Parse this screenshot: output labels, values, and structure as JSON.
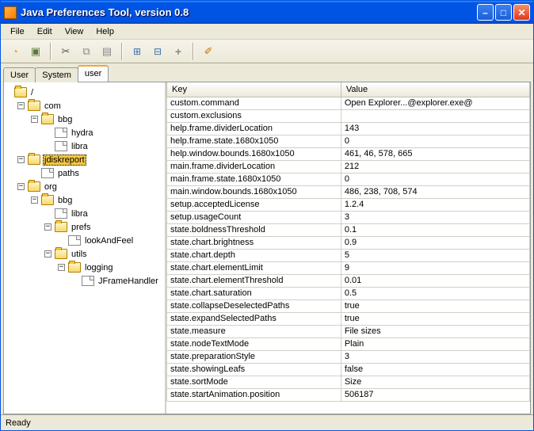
{
  "window": {
    "title": "Java Preferences Tool, version 0.8"
  },
  "menus": {
    "file": "File",
    "edit": "Edit",
    "view": "View",
    "help": "Help"
  },
  "tabs": {
    "user": "User",
    "system": "System",
    "user2": "user"
  },
  "table": {
    "headers": {
      "key": "Key",
      "value": "Value"
    },
    "rows": [
      {
        "k": "custom.command",
        "v": "Open Explorer...@explorer.exe@"
      },
      {
        "k": "custom.exclusions",
        "v": ""
      },
      {
        "k": "help.frame.dividerLocation",
        "v": "143"
      },
      {
        "k": "help.frame.state.1680x1050",
        "v": "0"
      },
      {
        "k": "help.window.bounds.1680x1050",
        "v": "461, 46, 578, 665"
      },
      {
        "k": "main.frame.dividerLocation",
        "v": "212"
      },
      {
        "k": "main.frame.state.1680x1050",
        "v": "0"
      },
      {
        "k": "main.window.bounds.1680x1050",
        "v": "486, 238, 708, 574"
      },
      {
        "k": "setup.acceptedLicense",
        "v": "1.2.4"
      },
      {
        "k": "setup.usageCount",
        "v": "3"
      },
      {
        "k": "state.boldnessThreshold",
        "v": "0.1"
      },
      {
        "k": "state.chart.brightness",
        "v": "0.9"
      },
      {
        "k": "state.chart.depth",
        "v": "5"
      },
      {
        "k": "state.chart.elementLimit",
        "v": "9"
      },
      {
        "k": "state.chart.elementThreshold",
        "v": "0.01"
      },
      {
        "k": "state.chart.saturation",
        "v": "0.5"
      },
      {
        "k": "state.collapseDeselectedPaths",
        "v": "true"
      },
      {
        "k": "state.expandSelectedPaths",
        "v": "true"
      },
      {
        "k": "state.measure",
        "v": "File sizes"
      },
      {
        "k": "state.nodeTextMode",
        "v": "Plain"
      },
      {
        "k": "state.preparationStyle",
        "v": "3"
      },
      {
        "k": "state.showingLeafs",
        "v": "false"
      },
      {
        "k": "state.sortMode",
        "v": "Size"
      },
      {
        "k": "state.startAnimation.position",
        "v": "506187"
      }
    ]
  },
  "tree": {
    "root": "/",
    "com": "com",
    "com_bbg": "bbg",
    "hydra": "hydra",
    "libra": "libra",
    "jdiskreport": "jdiskreport",
    "paths": "paths",
    "org": "org",
    "org_bbg": "bbg",
    "org_libra": "libra",
    "prefs": "prefs",
    "lookAndFeel": "lookAndFeel",
    "utils": "utils",
    "logging": "logging",
    "jframehandler": "JFrameHandler"
  },
  "status": {
    "text": "Ready"
  },
  "toolbar_icons": {
    "new": "●",
    "open": "■",
    "cut": "✂",
    "copy": "⧉",
    "paste": "📋",
    "expand": "⊞",
    "collapse": "⊟",
    "add": "+",
    "wand": "✎"
  }
}
